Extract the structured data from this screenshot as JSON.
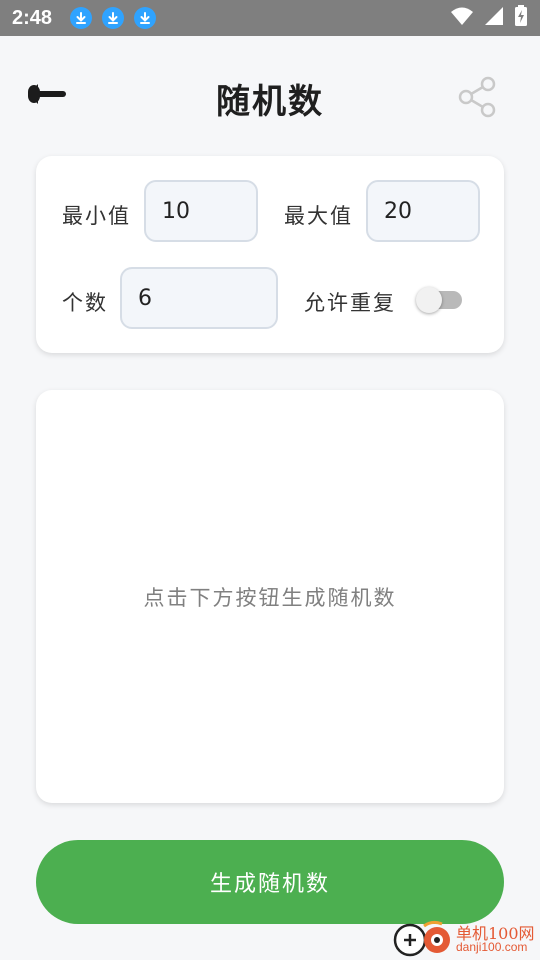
{
  "status_bar": {
    "time": "2:48",
    "download_icons": [
      "download-icon",
      "download-icon",
      "download-icon"
    ],
    "right_icons": [
      "wifi-icon",
      "signal-icon",
      "battery-charging-icon"
    ]
  },
  "header": {
    "title": "随机数",
    "back_icon": "back-arrow-icon",
    "share_icon": "share-icon"
  },
  "settings": {
    "min_label": "最小值",
    "min_value": "10",
    "max_label": "最大值",
    "max_value": "20",
    "count_label": "个数",
    "count_value": "6",
    "allow_repeat_label": "允许重复",
    "allow_repeat_on": false
  },
  "result": {
    "placeholder": "点击下方按钮生成随机数"
  },
  "generate_button": {
    "label": "生成随机数"
  },
  "watermark": {
    "cn": "单机100网",
    "en": "danji100.com"
  },
  "colors": {
    "accent": "#4caf50",
    "status_bar": "#7f7f7f",
    "download_badge": "#2fa3ff",
    "watermark": "#e45a35"
  }
}
